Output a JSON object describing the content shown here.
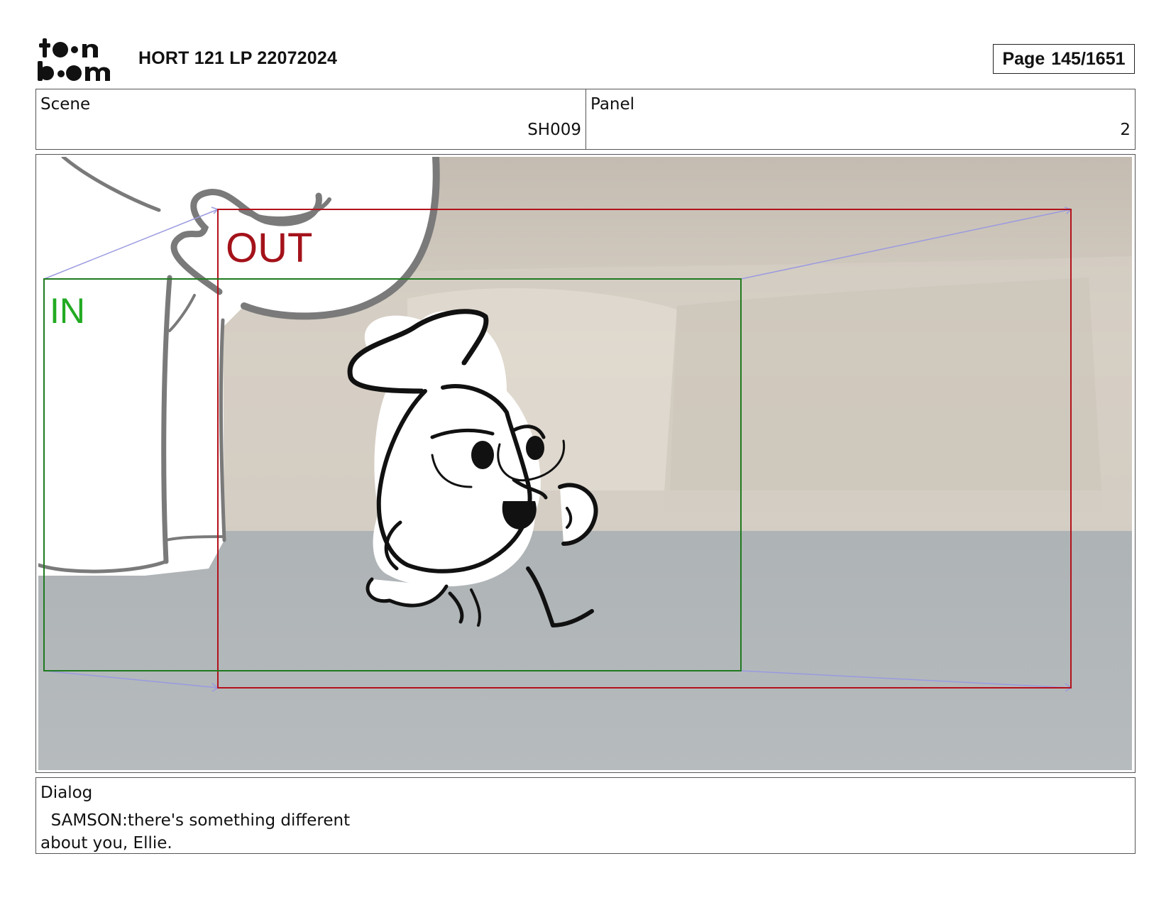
{
  "header": {
    "logo_text": "toon boom",
    "project_title": "HORT 121 LP 22072024",
    "page_label": "Page",
    "page_number": "145/1651"
  },
  "info": {
    "scene_label": "Scene",
    "scene_value": "SH009",
    "panel_label": "Panel",
    "panel_value": "2"
  },
  "frame": {
    "in_label": "IN",
    "out_label": "OUT",
    "colors": {
      "in_frame": "#1f7a1f",
      "in_text": "#22aa22",
      "out_frame": "#b3121b",
      "out_text": "#a4121a",
      "motion_path": "#9a9ae0",
      "wall": "#cfc7bb",
      "floor": "#b4b9bc"
    }
  },
  "dialog": {
    "label": "Dialog",
    "text": "  SAMSON:there's something different\nabout you, Ellie."
  }
}
